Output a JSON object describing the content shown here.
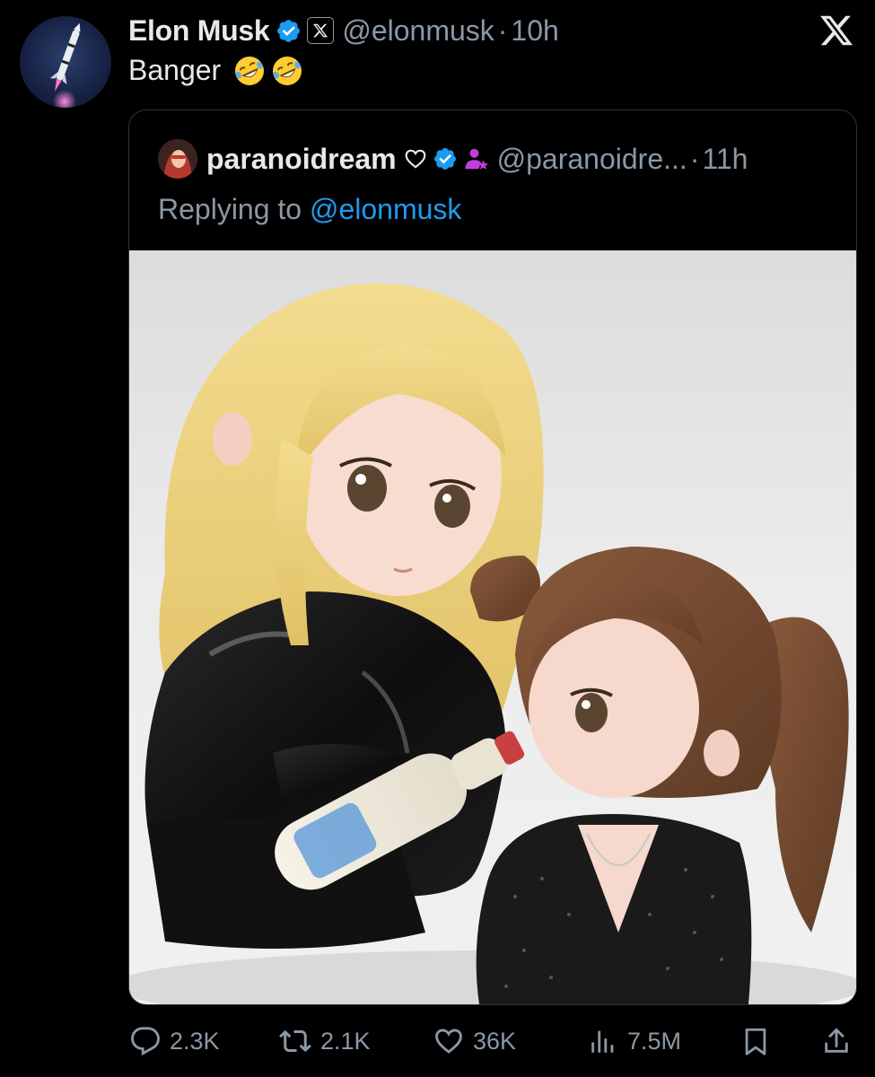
{
  "author": {
    "display_name": "Elon Musk",
    "handle": "@elonmusk",
    "separator": "·",
    "time": "10h",
    "verified": true,
    "affiliation_icon": "x-logo-icon",
    "avatar_icon": "rocket-avatar"
  },
  "tweet": {
    "text": "Banger",
    "emojis": [
      "rolling-on-floor-laughing",
      "rolling-on-floor-laughing"
    ]
  },
  "quoted_tweet": {
    "display_name": "paranoidream",
    "handle": "@paranoidre...",
    "separator": "·",
    "time": "11h",
    "badges": [
      "heart-outline-icon",
      "verified-icon",
      "person-star-icon"
    ],
    "reply_prefix": "Replying to",
    "reply_mention": "@elonmusk",
    "media_alt_icon": "figurine-image"
  },
  "actions": {
    "replies": "2.3K",
    "reposts": "2.1K",
    "likes": "36K",
    "views": "7.5M"
  },
  "colors": {
    "background": "#000000",
    "text_primary": "#e7e9ea",
    "text_secondary": "#8b98a5",
    "accent": "#1d9bf0",
    "verified": "#1d9bf0",
    "border": "#2f3336",
    "person_badge": "#c13fd9"
  }
}
